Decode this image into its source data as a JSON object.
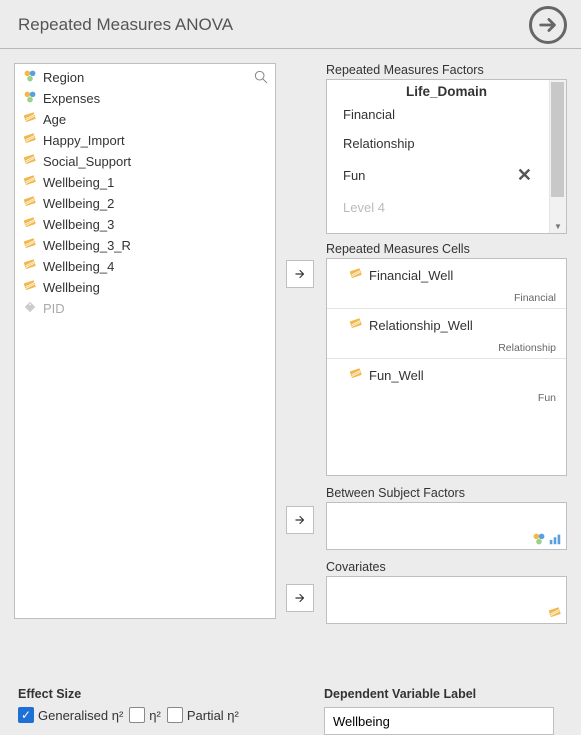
{
  "header": {
    "title": "Repeated Measures ANOVA"
  },
  "variables": [
    {
      "label": "Region",
      "iconType": "nominal",
      "dim": false
    },
    {
      "label": "Expenses",
      "iconType": "nominal",
      "dim": false
    },
    {
      "label": "Age",
      "iconType": "continuous",
      "dim": false
    },
    {
      "label": "Happy_Import",
      "iconType": "continuous",
      "dim": false
    },
    {
      "label": "Social_Support",
      "iconType": "continuous",
      "dim": false
    },
    {
      "label": "Wellbeing_1",
      "iconType": "continuous",
      "dim": false
    },
    {
      "label": "Wellbeing_2",
      "iconType": "continuous",
      "dim": false
    },
    {
      "label": "Wellbeing_3",
      "iconType": "continuous",
      "dim": false
    },
    {
      "label": "Wellbeing_3_R",
      "iconType": "continuous",
      "dim": false
    },
    {
      "label": "Wellbeing_4",
      "iconType": "continuous",
      "dim": false
    },
    {
      "label": "Wellbeing",
      "iconType": "continuous",
      "dim": false
    },
    {
      "label": "PID",
      "iconType": "id",
      "dim": true
    }
  ],
  "rmFactors": {
    "sectionLabel": "Repeated Measures Factors",
    "factorName": "Life_Domain",
    "levels": [
      {
        "label": "Financial",
        "placeholder": false,
        "showX": false
      },
      {
        "label": "Relationship",
        "placeholder": false,
        "showX": false
      },
      {
        "label": "Fun",
        "placeholder": false,
        "showX": true
      },
      {
        "label": "Level 4",
        "placeholder": true,
        "showX": false
      }
    ]
  },
  "rmCells": {
    "sectionLabel": "Repeated Measures Cells",
    "cells": [
      {
        "var": "Financial_Well",
        "level": "Financial"
      },
      {
        "var": "Relationship_Well",
        "level": "Relationship"
      },
      {
        "var": "Fun_Well",
        "level": "Fun"
      }
    ]
  },
  "between": {
    "sectionLabel": "Between Subject Factors"
  },
  "covariates": {
    "sectionLabel": "Covariates"
  },
  "footer": {
    "effectSize": {
      "title": "Effect Size",
      "options": [
        {
          "label": "Generalised η²",
          "checked": true
        },
        {
          "label": "η²",
          "checked": false
        },
        {
          "label": "Partial η²",
          "checked": false
        }
      ]
    },
    "dvLabel": {
      "title": "Dependent Variable Label",
      "value": "Wellbeing"
    }
  }
}
